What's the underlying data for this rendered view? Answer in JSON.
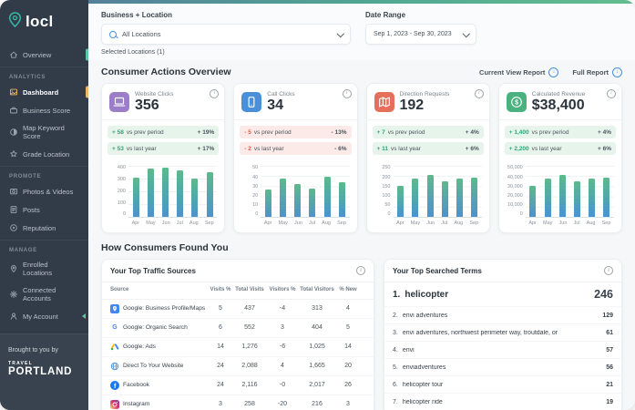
{
  "app": {
    "logo": "locl"
  },
  "colors": {
    "accent_teal": "#35b5a4",
    "indicator_green": "#57c99b",
    "indicator_orange": "#f0b860",
    "positive": "#2fa577",
    "negative": "#e05a49",
    "link_blue": "#4a90d9",
    "bar_gradient_top": "#5cba8b",
    "bar_gradient_bottom": "#4b93cf",
    "sidebar_bg": "#323c49"
  },
  "sidebar": {
    "sections": [
      {
        "label": "",
        "items": [
          {
            "label": "Overview",
            "icon": "home-icon",
            "indicator": "#57c99b"
          }
        ]
      },
      {
        "label": "ANALYTICS",
        "items": [
          {
            "label": "Dashboard",
            "icon": "dashboard-icon",
            "active": true,
            "indicator": "#f0b860"
          },
          {
            "label": "Business Score",
            "icon": "briefcase-icon"
          },
          {
            "label": "Map Keyword Score",
            "icon": "contrast-icon"
          },
          {
            "label": "Grade Location",
            "icon": "grade-icon"
          }
        ]
      },
      {
        "label": "PROMOTE",
        "items": [
          {
            "label": "Photos & Videos",
            "icon": "photos-icon"
          },
          {
            "label": "Posts",
            "icon": "posts-icon"
          },
          {
            "label": "Reputation",
            "icon": "reputation-icon"
          }
        ]
      },
      {
        "label": "MANAGE",
        "items": [
          {
            "label": "Enrolled Locations",
            "icon": "pin-icon"
          },
          {
            "label": "Connected Accounts",
            "icon": "connected-icon"
          },
          {
            "label": "My Account",
            "icon": "account-icon",
            "collapse": true
          }
        ]
      }
    ],
    "footer": {
      "brought_text": "Brought to you by",
      "brand_small": "TRAVEL",
      "brand_large": "PORTLAND"
    }
  },
  "topbar": {
    "business_location_label": "Business + Location",
    "location_value": "All Locations",
    "selected_locations": "Selected Locations (1)",
    "date_range_label": "Date Range",
    "date_range_value": "Sep 1, 2023 - Sep 30, 2023"
  },
  "consumer_actions": {
    "title": "Consumer Actions Overview",
    "current_view_report": "Current View Report",
    "full_report": "Full Report",
    "cards": [
      {
        "label": "Website Clicks",
        "value": "356",
        "icon": "website-icon",
        "icon_bg": "#9b7ec7",
        "stats": [
          {
            "delta": "+ 58",
            "text": "vs prev period",
            "pct": "+ 19%",
            "positive": true
          },
          {
            "delta": "+ 53",
            "text": "vs last year",
            "pct": "+ 17%",
            "positive": true
          }
        ]
      },
      {
        "label": "Call Clicks",
        "value": "34",
        "icon": "phone-icon",
        "icon_bg": "#4a90d9",
        "stats": [
          {
            "delta": "- 5",
            "text": "vs prev period",
            "pct": "- 13%",
            "positive": false
          },
          {
            "delta": "- 2",
            "text": "vs last year",
            "pct": "- 6%",
            "positive": false
          }
        ]
      },
      {
        "label": "Direction Requests",
        "value": "192",
        "icon": "map-icon",
        "icon_bg": "#e4705c",
        "stats": [
          {
            "delta": "+ 7",
            "text": "vs prev period",
            "pct": "+ 4%",
            "positive": true
          },
          {
            "delta": "+ 11",
            "text": "vs last year",
            "pct": "+ 6%",
            "positive": true
          }
        ]
      },
      {
        "label": "Calculated Revenue",
        "value": "$38,400",
        "icon": "dollar-icon",
        "icon_bg": "#49b27e",
        "stats": [
          {
            "delta": "+ 1,400",
            "text": "vs prev period",
            "pct": "+ 4%",
            "positive": true
          },
          {
            "delta": "+ 2,200",
            "text": "vs last year",
            "pct": "+ 6%",
            "positive": true
          }
        ]
      }
    ]
  },
  "chart_data": [
    {
      "type": "bar",
      "title": "Website Clicks",
      "categories": [
        "Apr",
        "May",
        "Jun",
        "Jul",
        "Aug",
        "Sep"
      ],
      "values": [
        310,
        380,
        385,
        365,
        305,
        355
      ],
      "yticks": [
        "400",
        "300",
        "200",
        "100",
        "0"
      ],
      "ylim": [
        0,
        400
      ],
      "grid": true,
      "legend": "none"
    },
    {
      "type": "bar",
      "title": "Call Clicks",
      "categories": [
        "Apr",
        "May",
        "Jun",
        "Jul",
        "Aug",
        "Sep"
      ],
      "values": [
        27,
        38,
        32,
        28,
        40,
        34
      ],
      "yticks": [
        "50",
        "40",
        "30",
        "20",
        "10",
        "0"
      ],
      "ylim": [
        0,
        50
      ],
      "grid": true,
      "legend": "none"
    },
    {
      "type": "bar",
      "title": "Direction Requests",
      "categories": [
        "Apr",
        "May",
        "Jun",
        "Jul",
        "Aug",
        "Sep"
      ],
      "values": [
        155,
        190,
        205,
        175,
        188,
        192
      ],
      "yticks": [
        "250",
        "200",
        "150",
        "100",
        "50",
        "0"
      ],
      "ylim": [
        0,
        250
      ],
      "grid": true,
      "legend": "none"
    },
    {
      "type": "bar",
      "title": "Calculated Revenue",
      "categories": [
        "Apr",
        "May",
        "Jun",
        "Jul",
        "Aug",
        "Sep"
      ],
      "values": [
        31000,
        38000,
        41000,
        35000,
        38000,
        38400
      ],
      "yticks": [
        "50,000",
        "40,000",
        "30,000",
        "20,000",
        "10,000",
        "0"
      ],
      "ylim": [
        0,
        50000
      ],
      "grid": true,
      "legend": "none"
    }
  ],
  "found_you": {
    "title": "How Consumers Found You",
    "traffic": {
      "title": "Your Top Traffic Sources",
      "columns": [
        "Source",
        "Visits %",
        "Total Visits",
        "Visitors %",
        "Total Visitors",
        "% New"
      ],
      "rows": [
        {
          "icon": "google-maps-icon",
          "source": "Google: Business Profile/Maps",
          "visits_pct": "5",
          "total_visits": "437",
          "visitors_pct": "-4",
          "total_visitors": "313",
          "new_pct": "4"
        },
        {
          "icon": "google-search-icon",
          "source": "Google: Organic Search",
          "visits_pct": "6",
          "total_visits": "552",
          "visitors_pct": "3",
          "total_visitors": "404",
          "new_pct": "5"
        },
        {
          "icon": "google-ads-icon",
          "source": "Google: Ads",
          "visits_pct": "14",
          "total_visits": "1,276",
          "visitors_pct": "-6",
          "total_visitors": "1,025",
          "new_pct": "14"
        },
        {
          "icon": "globe-icon",
          "source": "Direct To Your Website",
          "visits_pct": "24",
          "total_visits": "2,088",
          "visitors_pct": "4",
          "total_visitors": "1,665",
          "new_pct": "20"
        },
        {
          "icon": "facebook-icon",
          "source": "Facebook",
          "visits_pct": "24",
          "total_visits": "2,116",
          "visitors_pct": "-0",
          "total_visitors": "2,017",
          "new_pct": "26"
        },
        {
          "icon": "instagram-icon",
          "source": "Instagram",
          "visits_pct": "3",
          "total_visits": "258",
          "visitors_pct": "-20",
          "total_visitors": "216",
          "new_pct": "3"
        }
      ]
    },
    "terms": {
      "title": "Your Top Searched Terms",
      "items": [
        {
          "rank": "1.",
          "term": "helicopter",
          "count": "246",
          "featured": true
        },
        {
          "rank": "2.",
          "term": "envi adventures",
          "count": "129"
        },
        {
          "rank": "3.",
          "term": "envi adventures, northwest perimeter way, troutdale, or",
          "count": "61"
        },
        {
          "rank": "4.",
          "term": "envi",
          "count": "57"
        },
        {
          "rank": "5.",
          "term": "enviadventures",
          "count": "56"
        },
        {
          "rank": "6.",
          "term": "helicopter tour",
          "count": "21"
        },
        {
          "rank": "7.",
          "term": "helicopter ride",
          "count": "19"
        }
      ]
    }
  }
}
